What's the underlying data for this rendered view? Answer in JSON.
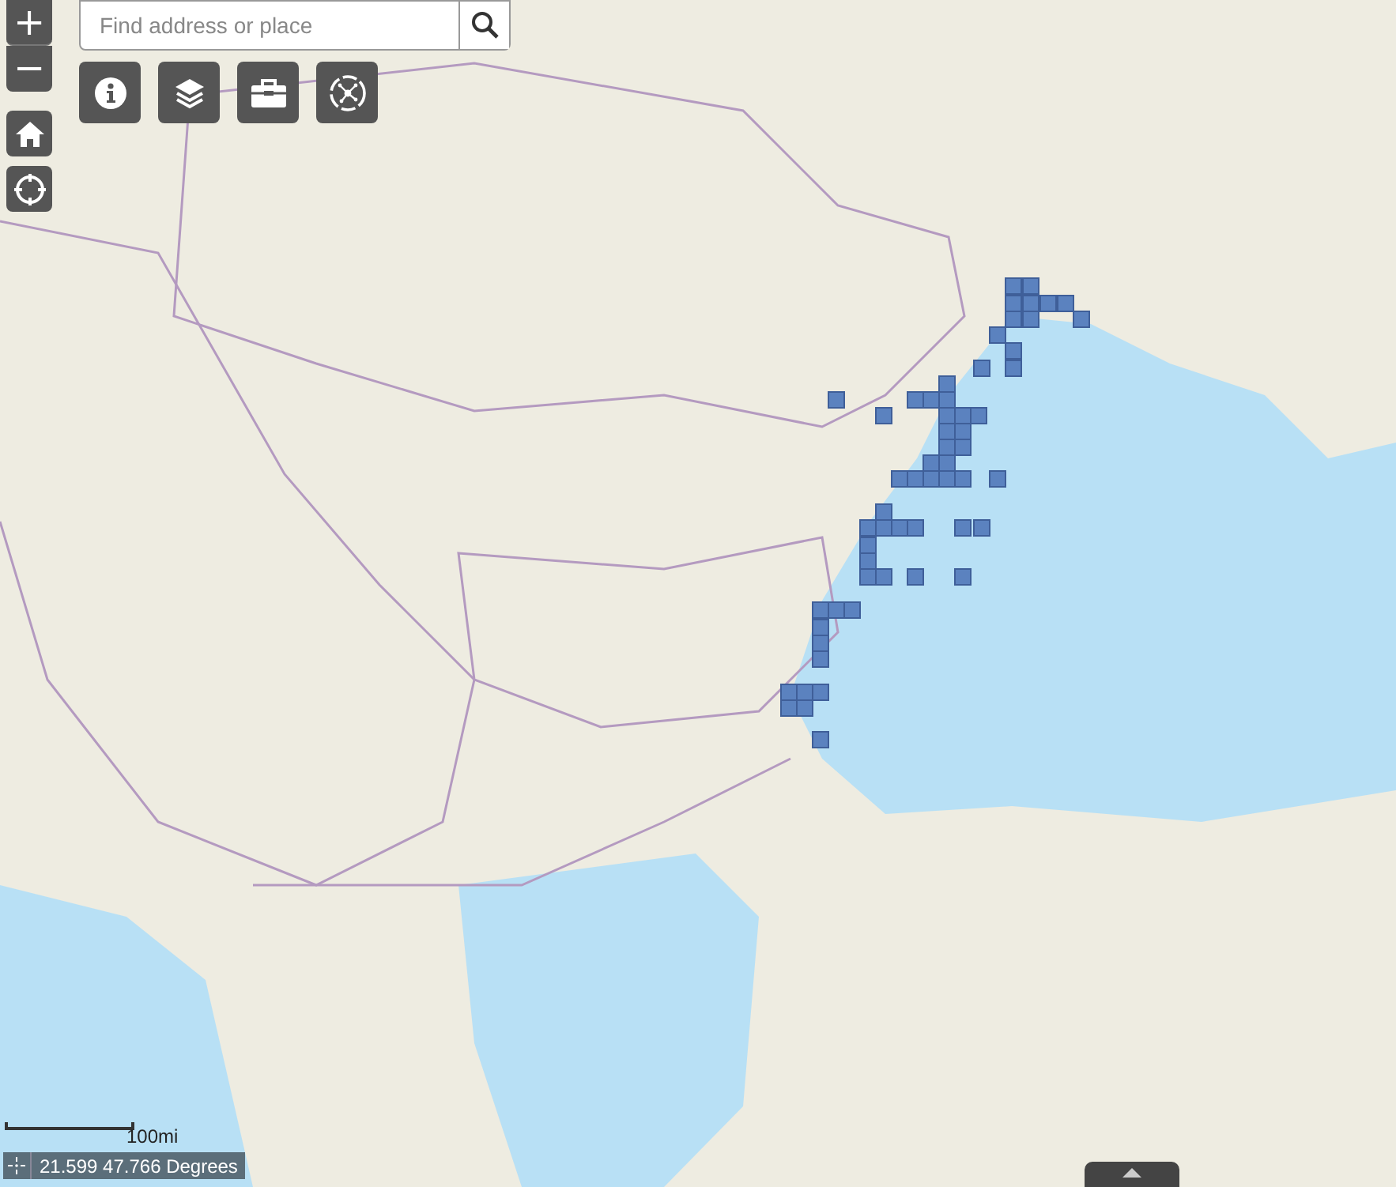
{
  "search": {
    "placeholder": "Find address or place"
  },
  "zoom_controls": {
    "zoom_in": "+",
    "zoom_out": "−"
  },
  "scale_bar": {
    "label": "100mi"
  },
  "coordinates": {
    "value": "21.599 47.766 Degrees"
  }
}
